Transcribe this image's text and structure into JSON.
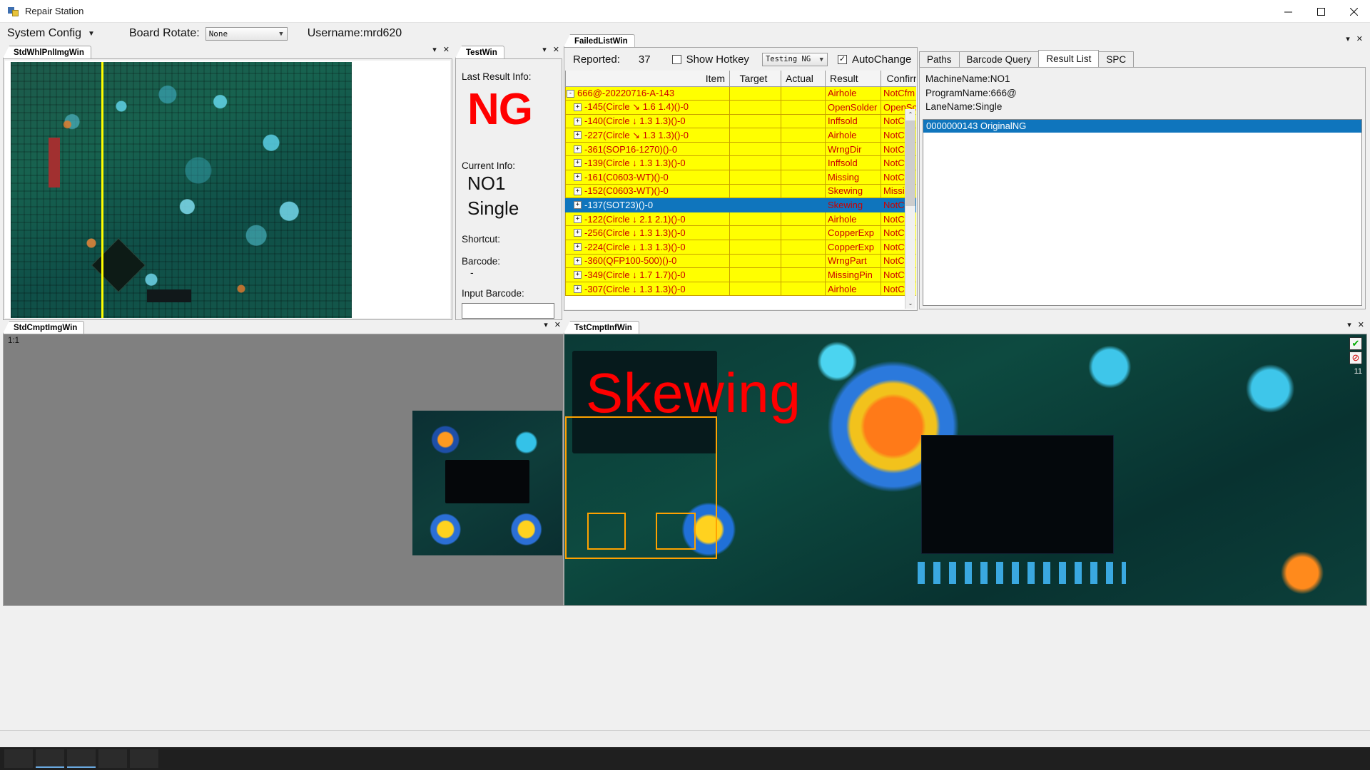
{
  "window": {
    "title": "Repair Station",
    "minimize": "–",
    "maximize": "□",
    "close": "✕"
  },
  "toolbar": {
    "system_config": "System Config",
    "board_rotate_label": "Board Rotate:",
    "board_rotate_value": "None",
    "username": "Username:mrd620"
  },
  "std_panel": {
    "tab": "StdWhlPnlImgWin"
  },
  "test_panel": {
    "tab": "TestWin",
    "last_result_label": "Last Result Info:",
    "last_result_value": "NG",
    "current_info_label": "Current Info:",
    "machine": "NO1",
    "lane": "Single",
    "shortcut_label": "Shortcut:",
    "barcode_label": "Barcode:",
    "barcode_value": "-",
    "input_barcode_label": "Input Barcode:",
    "input_barcode_value": ""
  },
  "failed_panel": {
    "tab": "FailedListWin",
    "reported_label": "Reported:",
    "reported_count": "37",
    "show_hotkey_label": "Show Hotkey",
    "show_hotkey_checked": false,
    "status_value": "Testing NG",
    "auto_change_label": "AutoChange",
    "auto_change_checked": true,
    "columns": [
      "Item",
      "Target",
      "Actual",
      "Result",
      "Confirm"
    ],
    "rows": [
      {
        "expander": "-",
        "level": "root",
        "item": "666@-20220716-A-143",
        "target": "",
        "actual": "",
        "result": "Airhole",
        "confirm": "NotCfm",
        "selected": false
      },
      {
        "expander": "+",
        "level": "child",
        "item": "-145(Circle ↘ 1.6 1.4)()-0",
        "target": "",
        "actual": "",
        "result": "OpenSolder",
        "confirm": "OpenSolde",
        "selected": false
      },
      {
        "expander": "+",
        "level": "child",
        "item": "-140(Circle ↓ 1.3 1.3)()-0",
        "target": "",
        "actual": "",
        "result": "Inffsold",
        "confirm": "NotCfm",
        "selected": false
      },
      {
        "expander": "+",
        "level": "child",
        "item": "-227(Circle ↘ 1.3 1.3)()-0",
        "target": "",
        "actual": "",
        "result": "Airhole",
        "confirm": "NotCfm",
        "selected": false
      },
      {
        "expander": "+",
        "level": "child",
        "item": "-361(SOP16-1270)()-0",
        "target": "",
        "actual": "",
        "result": "WrngDir",
        "confirm": "NotCfm",
        "selected": false
      },
      {
        "expander": "+",
        "level": "child",
        "item": "-139(Circle ↓ 1.3 1.3)()-0",
        "target": "",
        "actual": "",
        "result": "Inffsold",
        "confirm": "NotCfm",
        "selected": false
      },
      {
        "expander": "+",
        "level": "child",
        "item": "-161(C0603-WT)()-0",
        "target": "",
        "actual": "",
        "result": "Missing",
        "confirm": "NotCfm",
        "selected": false
      },
      {
        "expander": "+",
        "level": "child",
        "item": "-152(C0603-WT)()-0",
        "target": "",
        "actual": "",
        "result": "Skewing",
        "confirm": "Missing",
        "selected": false
      },
      {
        "expander": "+",
        "level": "child",
        "item": "-137(SOT23)()-0",
        "target": "",
        "actual": "",
        "result": "Skewing",
        "confirm": "NotCfm",
        "selected": true
      },
      {
        "expander": "+",
        "level": "child",
        "item": "-122(Circle ↓ 2.1 2.1)()-0",
        "target": "",
        "actual": "",
        "result": "Airhole",
        "confirm": "NotCfm",
        "selected": false
      },
      {
        "expander": "+",
        "level": "child",
        "item": "-256(Circle ↓ 1.3 1.3)()-0",
        "target": "",
        "actual": "",
        "result": "CopperExp",
        "confirm": "NotCfm",
        "selected": false
      },
      {
        "expander": "+",
        "level": "child",
        "item": "-224(Circle ↓ 1.3 1.3)()-0",
        "target": "",
        "actual": "",
        "result": "CopperExp",
        "confirm": "NotCfm",
        "selected": false
      },
      {
        "expander": "+",
        "level": "child",
        "item": "-360(QFP100-500)()-0",
        "target": "",
        "actual": "",
        "result": "WrngPart",
        "confirm": "NotCfm",
        "selected": false
      },
      {
        "expander": "+",
        "level": "child",
        "item": "-349(Circle ↓ 1.7 1.7)()-0",
        "target": "",
        "actual": "",
        "result": "MissingPin",
        "confirm": "NotCfm",
        "selected": false
      },
      {
        "expander": "+",
        "level": "child",
        "item": "-307(Circle ↓ 1.3 1.3)()-0",
        "target": "",
        "actual": "",
        "result": "Airhole",
        "confirm": "NotCfm",
        "selected": false
      }
    ]
  },
  "right_panel": {
    "tabs": [
      "Paths",
      "Barcode Query",
      "Result List",
      "SPC"
    ],
    "active_tab": "Result List",
    "info_lines": [
      "MachineName:NO1",
      "ProgramName:666@",
      "LaneName:Single"
    ],
    "list_items": [
      "0000000143 OriginalNG"
    ]
  },
  "cmp_panel": {
    "tab": "StdCmptImgWin",
    "ratio": "1:1"
  },
  "tst_panel": {
    "tab": "TstCmptInfWin",
    "defect_label": "Skewing",
    "ok_mark": "✔",
    "ng_mark": "⊘",
    "counter": "11"
  },
  "colors": {
    "highlight_row": "#0f75bd",
    "defect_bg": "#ffff00",
    "defect_text": "#cc0000",
    "ng_red": "#ff0000",
    "box_orange": "#ffa200",
    "crosshair": "#ffff00"
  },
  "icons": {
    "dropdown_arrow": "⌄",
    "panel_menu": "▾",
    "panel_close": "✕",
    "scroll_up": "⌃",
    "scroll_down": "⌄"
  }
}
